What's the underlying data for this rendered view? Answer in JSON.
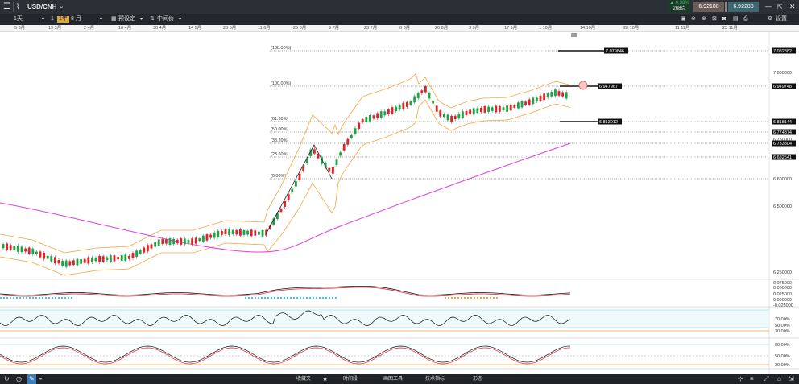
{
  "topbar": {
    "symbol": "USD/CNH",
    "change_pct": "▲ 0.38%",
    "change_pts": "268点",
    "bid": "6.92188",
    "ask": "6.92288"
  },
  "toolbar": {
    "interval": "1天",
    "t_1": "1",
    "t_8month": "8 月",
    "preset": "预设定",
    "price_type": "中间价",
    "settings": "设置"
  },
  "dates": [
    "5 3月",
    "19 3月",
    "2 4月",
    "16 4月",
    "30 4月",
    "14 5月",
    "28 5月",
    "11 6月",
    "25 6月",
    "9 7月",
    "23 7月",
    "6 8月",
    "20 8月",
    "3 9月",
    "17 9月",
    "1 10月",
    "14 10月",
    "28 10月",
    "11 11月",
    "25 11月"
  ],
  "fib_levels": [
    "(138.00%)",
    "(100.00%)",
    "(61.80%)",
    "(50.00%)",
    "(38.20%)",
    "(23.60%)",
    "(0.00%)"
  ],
  "price_axis": {
    "main": [
      "7.082882",
      "7.000000",
      "6.949748",
      "6.818144",
      "6.774874",
      "6.750000",
      "6.733804",
      "6.682541",
      "6.600000",
      "6.500000",
      "6.250000"
    ],
    "macd": [
      "0.075000",
      "0.050000",
      "0.025000",
      "0.000000",
      "-0.025000"
    ],
    "rsi": [
      "70.00%",
      "50.00%",
      "30.00%"
    ],
    "stoch": [
      "80.00%",
      "50.00%",
      "20.00%"
    ]
  },
  "chart_labels": {
    "tag1": "7.079846",
    "tag2": "6.947967",
    "tag3": "6.813012"
  },
  "bottombar": {
    "favorites": "收藏夹",
    "timeframe": "时间段",
    "draw_tools": "画图工具",
    "indicators": "技术指标",
    "shapes": "形态"
  },
  "colors": {
    "up": "#1aa54a",
    "down": "#d8262f",
    "bollinger": "#f5a640",
    "ma": "#e040e0",
    "bg_dark": "#2b2f36",
    "bid_bg": "#6b5c58",
    "ask_bg": "#3d6670"
  }
}
